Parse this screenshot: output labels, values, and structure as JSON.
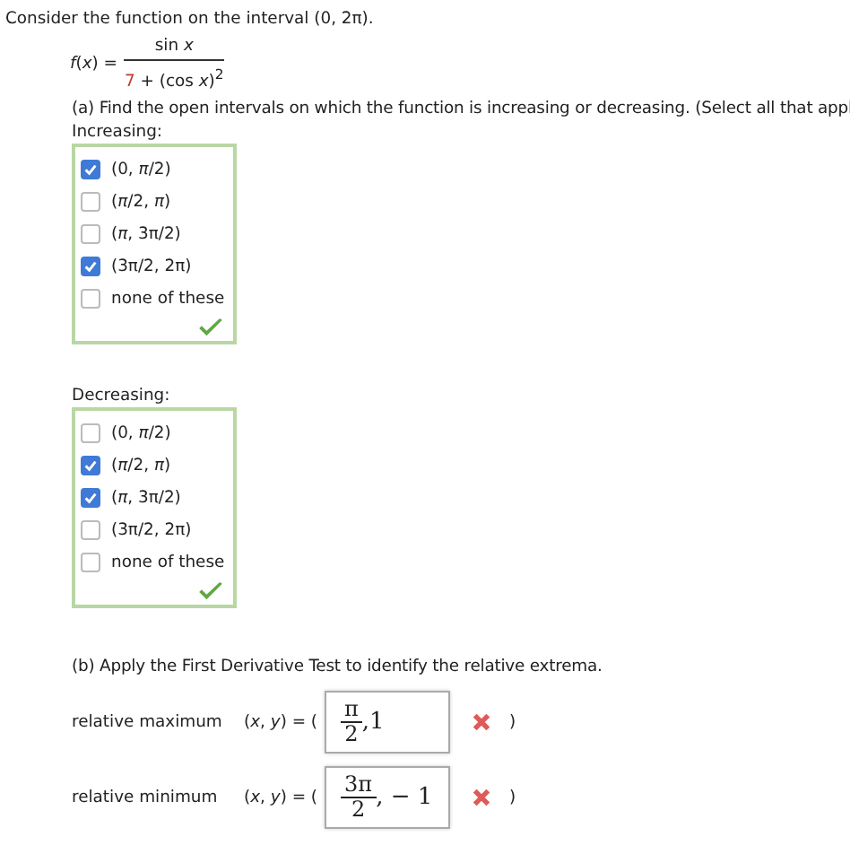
{
  "intro": "Consider the function on the interval (0, 2π).",
  "function": {
    "lhs": "*f*(*x*) =",
    "numerator": "sin *x*",
    "denominator_constant": "7",
    "denominator_rest": "+ (cos *x*)$^{2}$"
  },
  "part_a": {
    "prompt": "(a) Find the open intervals on which the function is increasing or decreasing. (Select all that appl",
    "groups": [
      {
        "label": "Increasing:",
        "correct": true,
        "options": [
          {
            "label": "(0, *π*/2)",
            "checked": true
          },
          {
            "label": "(*π*/2, *π*)",
            "checked": false
          },
          {
            "label": "(*π*, 3π/2)",
            "checked": false
          },
          {
            "label": "(3π/2, 2π)",
            "checked": true
          },
          {
            "label": "none of these",
            "checked": false
          }
        ]
      },
      {
        "label": "Decreasing:",
        "correct": true,
        "options": [
          {
            "label": "(0, *π*/2)",
            "checked": false
          },
          {
            "label": "(*π*/2, *π*)",
            "checked": true
          },
          {
            "label": "(*π*, 3π/2)",
            "checked": true
          },
          {
            "label": "(3π/2, 2π)",
            "checked": false
          },
          {
            "label": "none of these",
            "checked": false
          }
        ]
      }
    ]
  },
  "part_b": {
    "prompt": "(b) Apply the First Derivative Test to identify the relative extrema.",
    "rows": [
      {
        "label": "relative maximum",
        "prefix": "(*x*, *y*) = (",
        "answer_numerator": "π",
        "answer_denominator": "2",
        "answer_rest": ",1",
        "correct": false,
        "suffix": ")"
      },
      {
        "label": "relative minimum",
        "prefix": "(*x*, *y*) = (",
        "answer_numerator": "3π",
        "answer_denominator": "2",
        "answer_rest": ", − 1",
        "correct": false,
        "suffix": ")"
      }
    ]
  }
}
